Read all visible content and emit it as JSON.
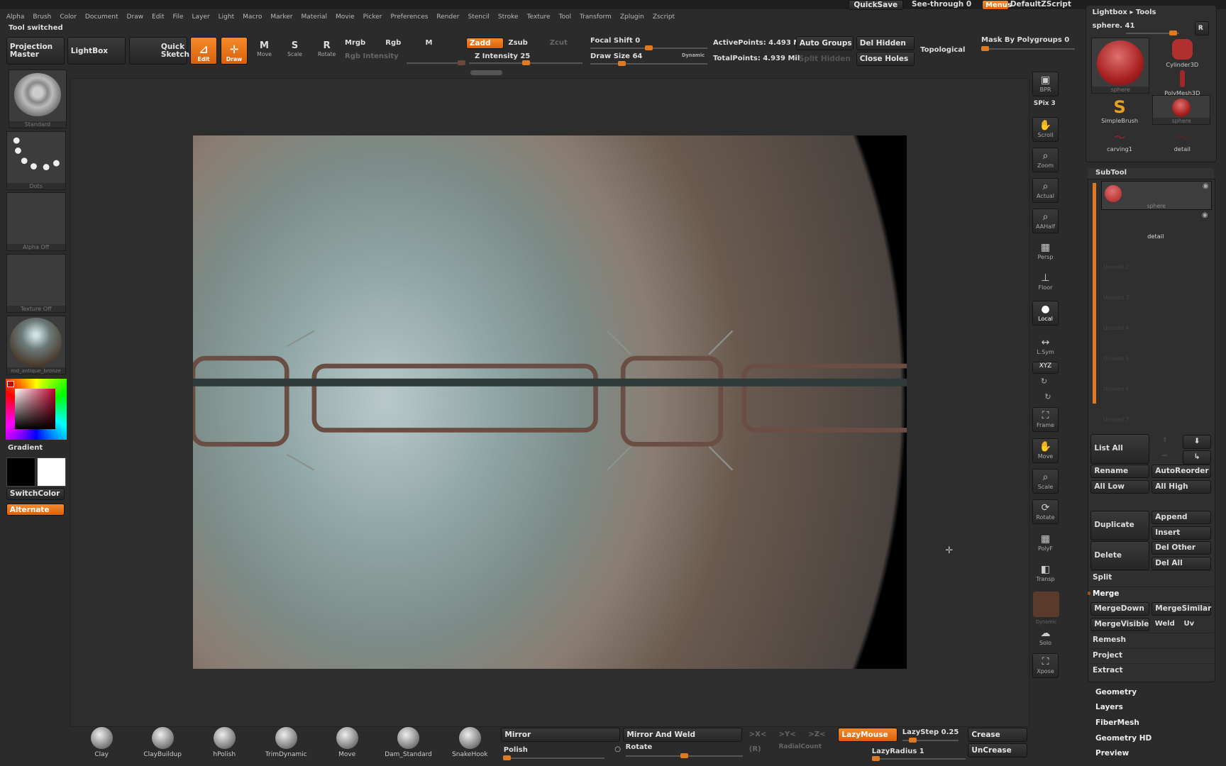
{
  "menubar": [
    "Alpha",
    "Brush",
    "Color",
    "Document",
    "Draw",
    "Edit",
    "File",
    "Layer",
    "Light",
    "Macro",
    "Marker",
    "Material",
    "Movie",
    "Picker",
    "Preferences",
    "Render",
    "Stencil",
    "Stroke",
    "Texture",
    "Tool",
    "Transform",
    "Zplugin",
    "Zscript"
  ],
  "topright": {
    "quicksave": "QuickSave",
    "see_through": "See-through 0",
    "menus": "Menus",
    "script": "DefaultZScript"
  },
  "status": "Tool switched",
  "toolbar": {
    "projection_master": "Projection Master",
    "lightbox": "LightBox",
    "quick_sketch": "Quick Sketch",
    "edit": "Edit",
    "draw": "Draw",
    "move": "Move",
    "scale": "Scale",
    "rotate": "Rotate",
    "mrgb": "Mrgb",
    "rgb": "Rgb",
    "m": "M",
    "rgb_intensity": "Rgb Intensity",
    "zadd": "Zadd",
    "zsub": "Zsub",
    "zcut": "Zcut",
    "z_intensity": "Z Intensity 25",
    "focal_shift": "Focal Shift 0",
    "draw_size": "Draw Size 64",
    "dynamic": "Dynamic",
    "active_points": "ActivePoints: 4.493 Mil",
    "total_points": "TotalPoints: 4.939 Mil",
    "auto_groups": "Auto Groups",
    "split_hidden": "Split Hidden",
    "del_hidden": "Del Hidden",
    "close_holes": "Close Holes",
    "topological": "Topological",
    "mask_by_polygroups": "Mask By Polygroups 0"
  },
  "left": {
    "brush": "Standard",
    "stroke": "Dots",
    "alpha": "Alpha Off",
    "texture": "Texture Off",
    "material": "md_antique_bronze",
    "gradient": "Gradient",
    "switch_color": "SwitchColor",
    "alternate": "Alternate"
  },
  "right_shelf": {
    "bpr": "BPR",
    "spix": "SPix 3",
    "items": [
      "Scroll",
      "Zoom",
      "Actual",
      "AAHalf",
      "Persp",
      "Floor",
      "Local",
      "L.Sym",
      "XYZ",
      "Frame",
      "Move",
      "Scale",
      "Rotate",
      "PolyF",
      "Transp",
      "Solo",
      "Xpose"
    ],
    "dynamic": "Dynamic"
  },
  "tool_panel": {
    "title": "Lightbox ▸ Tools",
    "current": "sphere. 41",
    "r": "R",
    "tools": [
      "sphere",
      "Cylinder3D",
      "PolyMesh3D",
      "SimpleBrush",
      "sphere",
      "carving1",
      "detail"
    ]
  },
  "subtool": {
    "title": "SubTool",
    "items": [
      "sphere",
      "detail"
    ],
    "empty": [
      "Unused 2",
      "Unused 3",
      "Unused 4",
      "Unused 5",
      "Unused 6",
      "Unused 7"
    ],
    "buttons": {
      "list_all": "List All",
      "rename": "Rename",
      "autoreorder": "AutoReorder",
      "all_low": "All Low",
      "all_high": "All High",
      "duplicate": "Duplicate",
      "append": "Append",
      "insert": "Insert",
      "delete": "Delete",
      "del_other": "Del Other",
      "del_all": "Del All",
      "split": "Split",
      "merge": "Merge",
      "merge_down": "MergeDown",
      "merge_similar": "MergeSimilar",
      "merge_visible": "MergeVisible",
      "weld": "Weld",
      "uv": "Uv",
      "remesh": "Remesh",
      "project": "Project",
      "extract": "Extract"
    }
  },
  "sections": [
    "Geometry",
    "Layers",
    "FiberMesh",
    "Geometry HD",
    "Preview"
  ],
  "bottom": {
    "brushes": [
      "Clay",
      "ClayBuildup",
      "hPolish",
      "TrimDynamic",
      "Move",
      "Dam_Standard",
      "SnakeHook"
    ],
    "mirror": "Mirror",
    "mirror_weld": "Mirror And Weld",
    "polish": "Polish",
    "rotate": "Rotate",
    "x": ">X<",
    "y": ">Y<",
    "z": ">Z<",
    "r": "(R)",
    "radial_count": "RadialCount",
    "lazymouse": "LazyMouse",
    "lazystep": "LazyStep 0.25",
    "lazyradius": "LazyRadius 1",
    "crease": "Crease",
    "uncrease": "UnCrease"
  },
  "colors": {
    "accent": "#e8761c",
    "bg": "#2b2b2b"
  }
}
